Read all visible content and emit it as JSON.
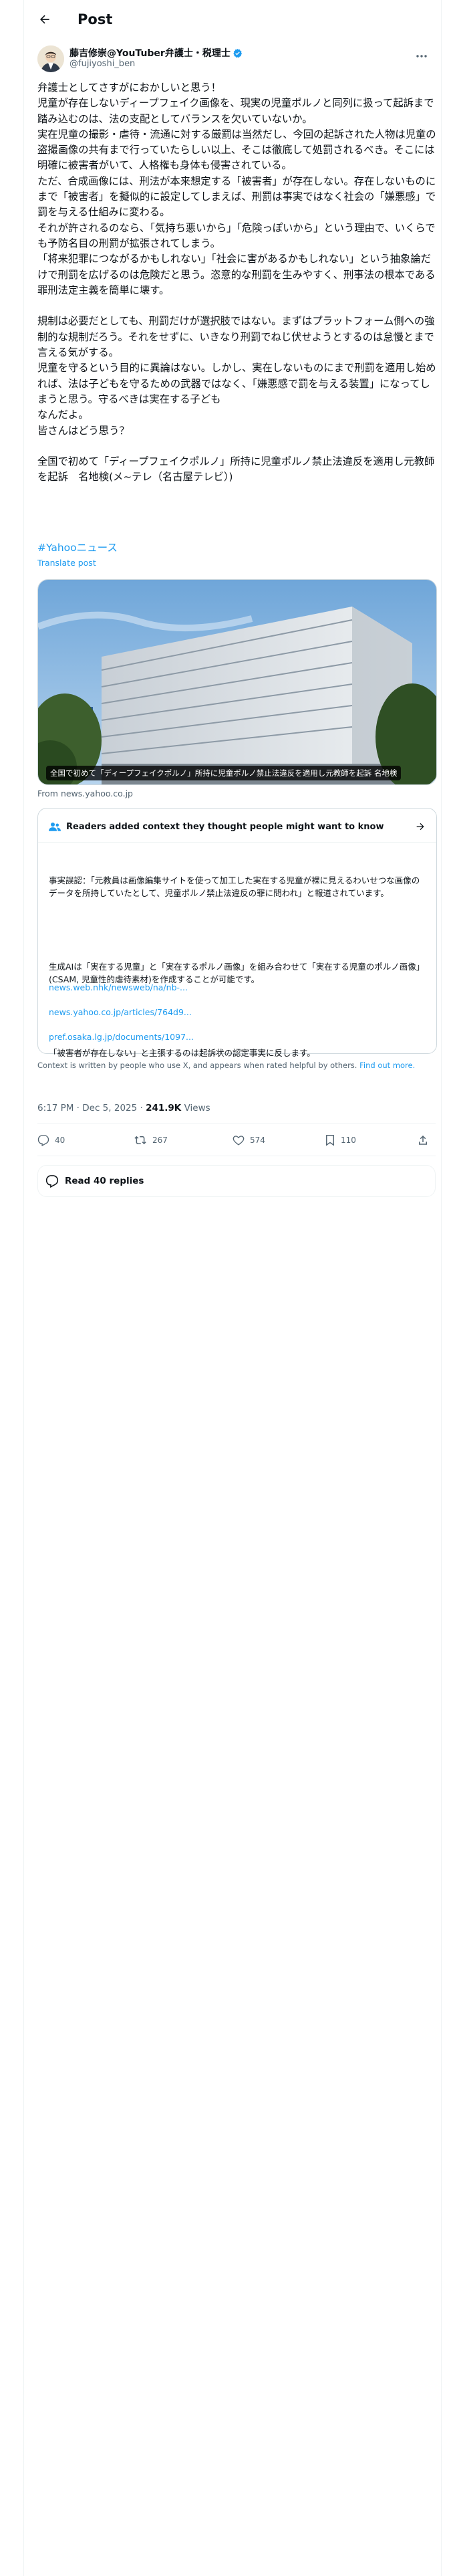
{
  "header": {
    "title": "Post",
    "back_icon": "arrow-left-icon"
  },
  "author": {
    "name": "藤吉修崇@YouTuber弁護士・税理士",
    "handle": "@fujiyoshi_ben",
    "verified": true,
    "accent": "#1d9bf0"
  },
  "post": {
    "body": "弁護士としてさすがにおかしいと思う！\n児童が存在しないディープフェイク画像を、現実の児童ポルノと同列に扱って起訴まで踏み込むのは、法の支配としてバランスを欠いていないか。\n実在児童の撮影・虐待・流通に対する厳罰は当然だし、今回の起訴された人物は児童の盗撮画像の共有まで行っていたらしい以上、そこは徹底して処罰されるべき。そこには明確に被害者がいて、人格権も身体も侵害されている。\nただ、合成画像には、刑法が本来想定する「被害者」が存在しない。存在しないものにまで「被害者」を擬似的に設定してしまえば、刑罰は事実ではなく社会の「嫌悪感」で罰を与える仕組みに変わる。\nそれが許されるのなら、「気持ち悪いから」「危険っぽいから」という理由で、いくらでも予防名目の刑罰が拡張されてしまう。\n「将来犯罪につながるかもしれない」「社会に害があるかもしれない」という抽象論だけで刑罰を広げるのは危険だと思う。恣意的な刑罰を生みやすく、刑事法の根本である罪刑法定主義を簡単に壊す。\n\n規制は必要だとしても、刑罰だけが選択肢ではない。まずはプラットフォーム側への強制的な規制だろう。それをせずに、いきなり刑罰でねじ伏せようとするのは怠慢とまで言える気がする。\n児童を守るという目的に異論はない。しかし、実在しないものにまで刑罰を適用し始めれば、法は子どもを守るための武器ではなく、「嫌悪感で罰を与える装置」になってしまうと思う。守るべきは実在する子ども\nなんだよ。\n皆さんはどう思う？\n\n全国で初めて「ディープフェイクポルノ」所持に児童ポルノ禁止法違反を適用し元教師を起訴　名地検(メ~テレ（名古屋テレビ）)",
    "hashtag": "#Yahooニュース",
    "translate": "Translate post",
    "timestamp": "6:17 PM · Dec 5, 2025",
    "views_count": "241.9K",
    "views_label": "Views"
  },
  "link_card": {
    "caption": "全国で初めて「ディープフェイクポルノ」所持に児童ポルノ禁止法違反を適用し元教師を起訴 名地検",
    "source": "From news.yahoo.co.jp"
  },
  "community_note": {
    "title": "Readers added context they thought people might want to know",
    "icon": "people-icon",
    "paragraphs": [
      "事実誤認：「元教員は画像編集サイトを使って加工した実在する児童が裸に見えるわいせつな画像のデータを所持していたとして、児童ポルノ禁止法違反の罪に問われ」と報道されています。",
      "生成AIは「実在する児童」と「実在するポルノ画像」を組み合わせて「実在する児童のポルノ画像」(CSAM, 児童性的虐待素材)を作成することが可能です。",
      "「被害者が存在しない」と主張するのは起訴状の認定事実に反します。"
    ],
    "links": [
      "news.web.nhk/newsweb/na/nb-...",
      "news.yahoo.co.jp/articles/764d9...",
      "pref.osaka.lg.jp/documents/1097..."
    ],
    "footer": "Context is written by people who use X, and appears when rated helpful by others.",
    "footer_link": "Find out more."
  },
  "actions": {
    "replies": "40",
    "reposts": "267",
    "likes": "574",
    "bookmarks": "110"
  },
  "read_replies": "Read 40 replies"
}
